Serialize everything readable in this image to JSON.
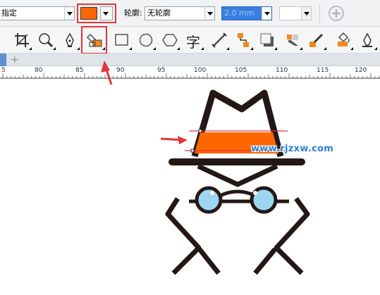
{
  "propbar": {
    "fill_mode_value": "指定",
    "fill_color": "#ff6600",
    "outline_label": "轮廓:",
    "outline_value": "无轮廓",
    "width_value": "2.0 mm"
  },
  "toolbox": {
    "tools": [
      "crop-tool-icon",
      "zoom-tool-icon",
      "pen-tool-icon",
      "smart-fill-tool-icon",
      "rectangle-tool-icon",
      "ellipse-tool-icon",
      "polygon-tool-icon",
      "text-tool-icon",
      "dimension-tool-icon",
      "connector-tool-icon",
      "shadow-tool-icon",
      "transparency-tool-icon",
      "eyedropper-tool-icon",
      "fill-tool-icon",
      "outline-pen-tool-icon"
    ],
    "text_tool_glyph": "字"
  },
  "ruler": {
    "ticks": [
      "5",
      "80",
      "85",
      "90",
      "95",
      "100",
      "105",
      "110",
      "115",
      "120"
    ]
  },
  "canvas": {
    "watermark": "www.rjzxw.com"
  },
  "colors": {
    "highlight": "#e2353b",
    "orange": "#ff6600",
    "ink": "#231815",
    "lens": "#9dd6f2",
    "watermark": "#2d7fd3"
  }
}
